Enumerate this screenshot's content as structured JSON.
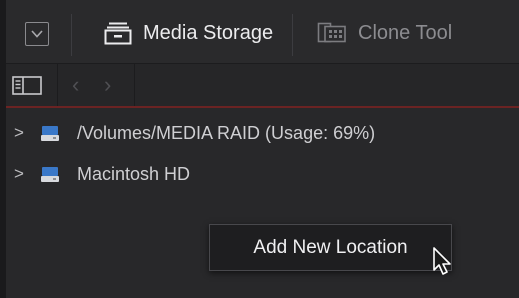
{
  "tabs": [
    {
      "label": "Media Storage",
      "icon": "storage-drawer-icon",
      "active": true
    },
    {
      "label": "Clone Tool",
      "icon": "clone-tool-icon",
      "active": false
    }
  ],
  "storage_list": [
    {
      "label": "/Volumes/MEDIA RAID (Usage: 69%)",
      "icon": "hard-drive-icon",
      "expanded": false
    },
    {
      "label": "Macintosh HD",
      "icon": "hard-drive-icon",
      "expanded": false
    }
  ],
  "context_menu": {
    "items": [
      {
        "label": "Add New Location"
      }
    ]
  },
  "colors": {
    "accent_line": "#6b2323",
    "drive_blue": "#3a78c8",
    "background": "#28282a"
  }
}
